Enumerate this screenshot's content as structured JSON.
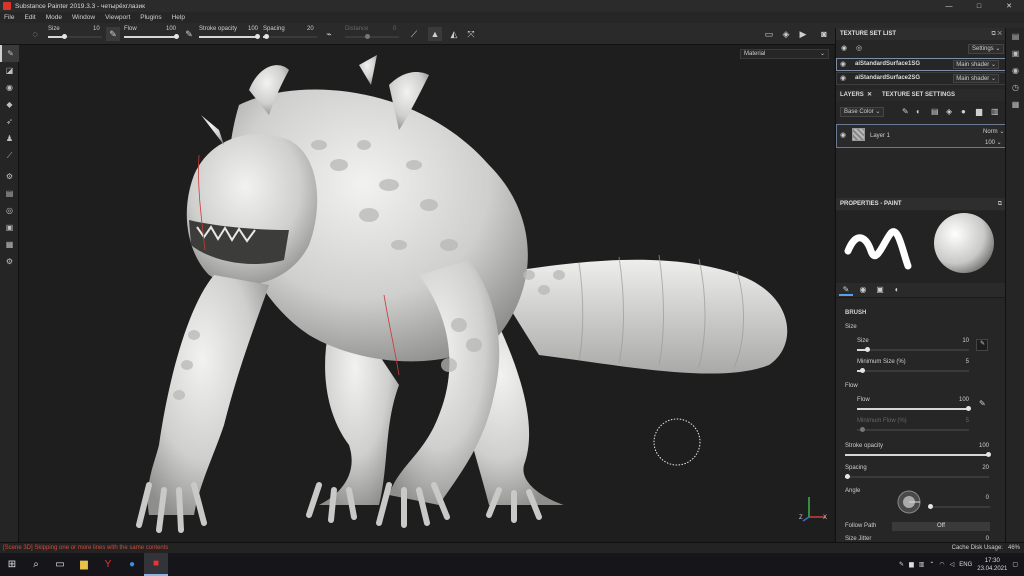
{
  "window": {
    "title": "Substance Painter 2019.3.3 - четырёхглазик",
    "buttons": [
      "—",
      "□",
      "✕"
    ]
  },
  "menu": [
    "File",
    "Edit",
    "Mode",
    "Window",
    "Viewport",
    "Plugins",
    "Help"
  ],
  "toolbar": {
    "size_label": "Size",
    "size_value": "10",
    "flow_label": "Flow",
    "flow_value": "100",
    "opacity_label": "Stroke opacity",
    "opacity_value": "100",
    "spacing_label": "Spacing",
    "spacing_value": "20",
    "distance_label": "Distance",
    "distance_value": "0"
  },
  "viewport": {
    "channel_select": "Material",
    "axis_labels": [
      "Z",
      "X"
    ]
  },
  "texture_set_list": {
    "title": "TEXTURE SET LIST",
    "settings_button": "Settings",
    "rows": [
      {
        "name": "aiStandardSurface1SG",
        "shader": "Main shader"
      },
      {
        "name": "aiStandardSurface2SG",
        "shader": "Main shader"
      }
    ]
  },
  "layers": {
    "tab_layers": "LAYERS",
    "tab_settings": "TEXTURE SET SETTINGS",
    "channel": "Base Color",
    "layer_name": "Layer 1",
    "blend_mode": "Norm",
    "opacity": "100"
  },
  "properties": {
    "title": "PROPERTIES - PAINT",
    "section": "BRUSH",
    "size_group": "Size",
    "size_label": "Size",
    "size_value": "10",
    "size_fraction": 0.1,
    "min_size_label": "Minimum Size (%)",
    "min_size_value": "5",
    "min_size_fraction": 0.05,
    "flow_group": "Flow",
    "flow_label": "Flow",
    "flow_value": "100",
    "flow_fraction": 1.0,
    "min_flow_label": "Minimum Flow (%)",
    "min_flow_value": "5",
    "stroke_opacity_label": "Stroke opacity",
    "stroke_opacity_value": "100",
    "stroke_opacity_fraction": 1.0,
    "spacing_label": "Spacing",
    "spacing_value": "20",
    "spacing_fraction": 0.02,
    "angle_label": "Angle",
    "angle_value": "0",
    "follow_path_label": "Follow Path",
    "follow_path_value": "Off",
    "size_jitter_label": "Size Jitter",
    "size_jitter_value": "0"
  },
  "status": {
    "message": "[Scene 3D] Skipping one or more lines with the same contents",
    "cache": "Cache Disk Usage:",
    "cache_value": "46%"
  },
  "taskbar": {
    "lang": "ENG",
    "time": "17:30",
    "date": "23.04.2021"
  }
}
